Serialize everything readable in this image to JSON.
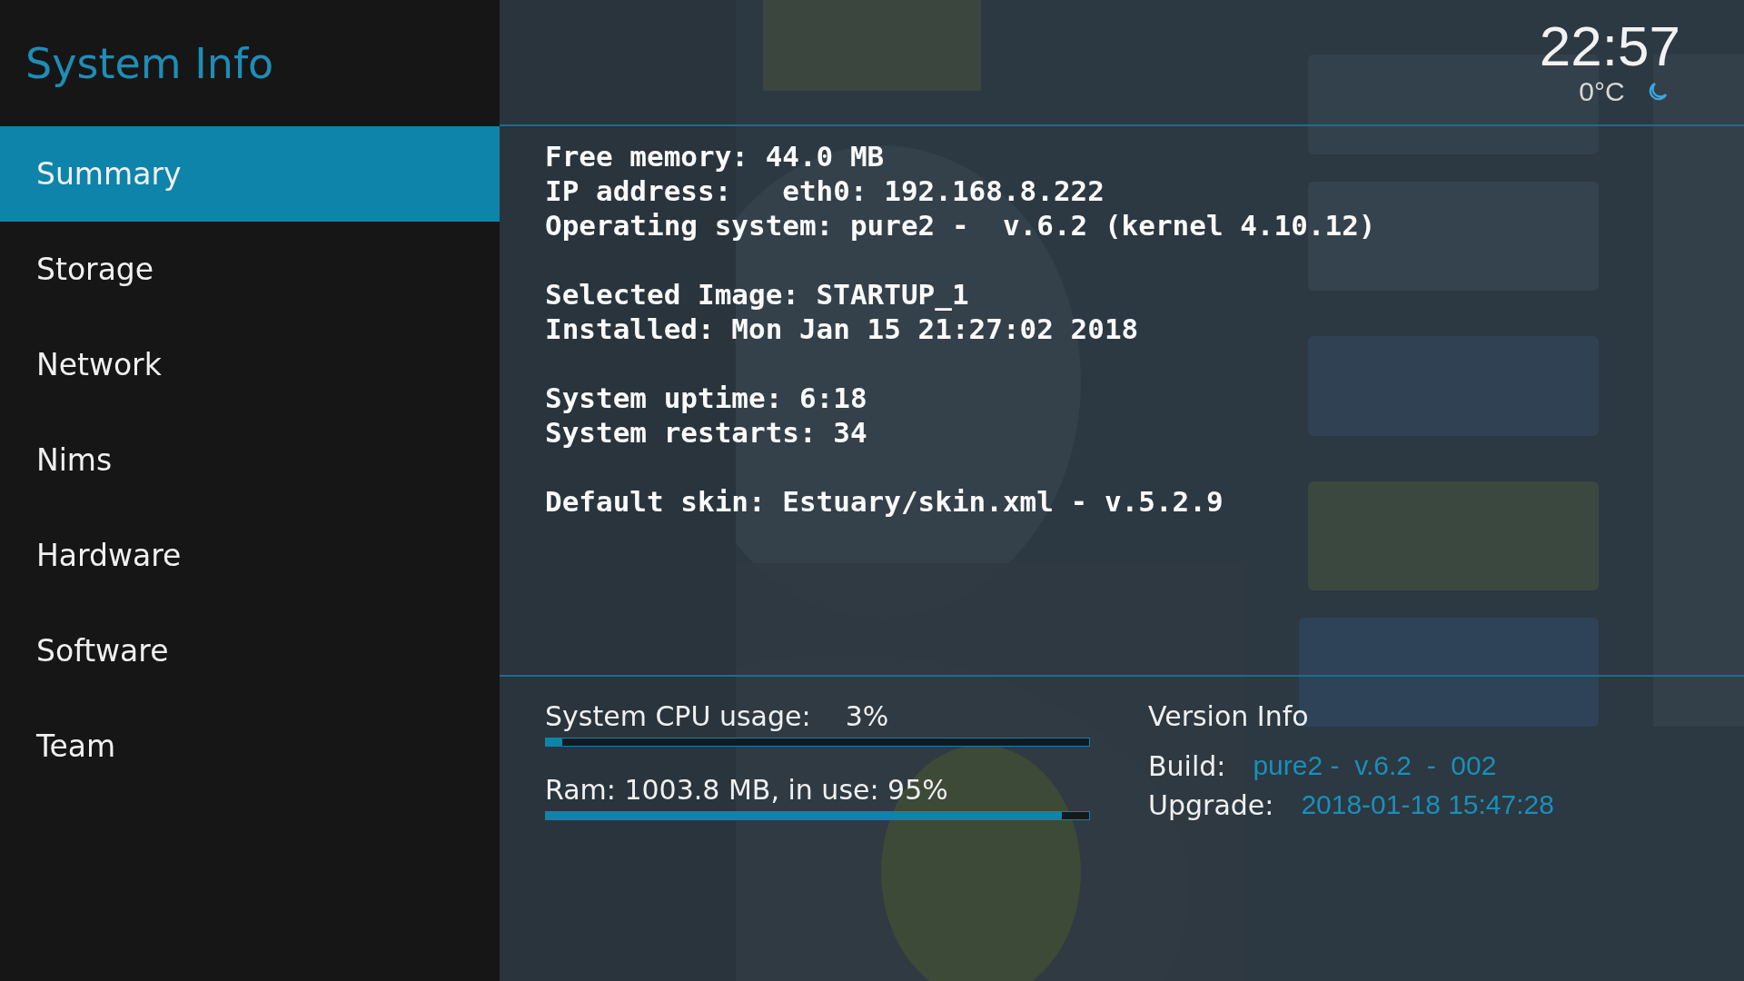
{
  "title": "System Info",
  "menu": [
    {
      "label": "Summary",
      "selected": true
    },
    {
      "label": "Storage",
      "selected": false
    },
    {
      "label": "Network",
      "selected": false
    },
    {
      "label": "Nims",
      "selected": false
    },
    {
      "label": "Hardware",
      "selected": false
    },
    {
      "label": "Software",
      "selected": false
    },
    {
      "label": "Team",
      "selected": false
    }
  ],
  "clock": {
    "time": "22:57",
    "temperature": "0°C"
  },
  "info_groups": [
    [
      "Free memory: 44.0 MB",
      "IP address:   eth0: 192.168.8.222",
      "Operating system: pure2 -  v.6.2 (kernel 4.10.12)"
    ],
    [
      "Selected Image: STARTUP_1",
      "Installed: Mon Jan 15 21:27:02 2018"
    ],
    [
      "System uptime: 6:18",
      "System restarts: 34"
    ],
    [
      "Default skin: Estuary/skin.xml - v.5.2.9"
    ]
  ],
  "meters": [
    {
      "label": "System CPU usage:    3%",
      "level": 0.03
    },
    {
      "label": "Ram: 1003.8 MB, in use: 95%",
      "level": 0.95
    }
  ],
  "version_info": {
    "heading": "Version Info",
    "rows": [
      {
        "label": "Build:",
        "value": "pure2 -  v.6.2  -  002"
      },
      {
        "label": "Upgrade:",
        "value": "2018-01-18 15:47:28"
      }
    ]
  }
}
